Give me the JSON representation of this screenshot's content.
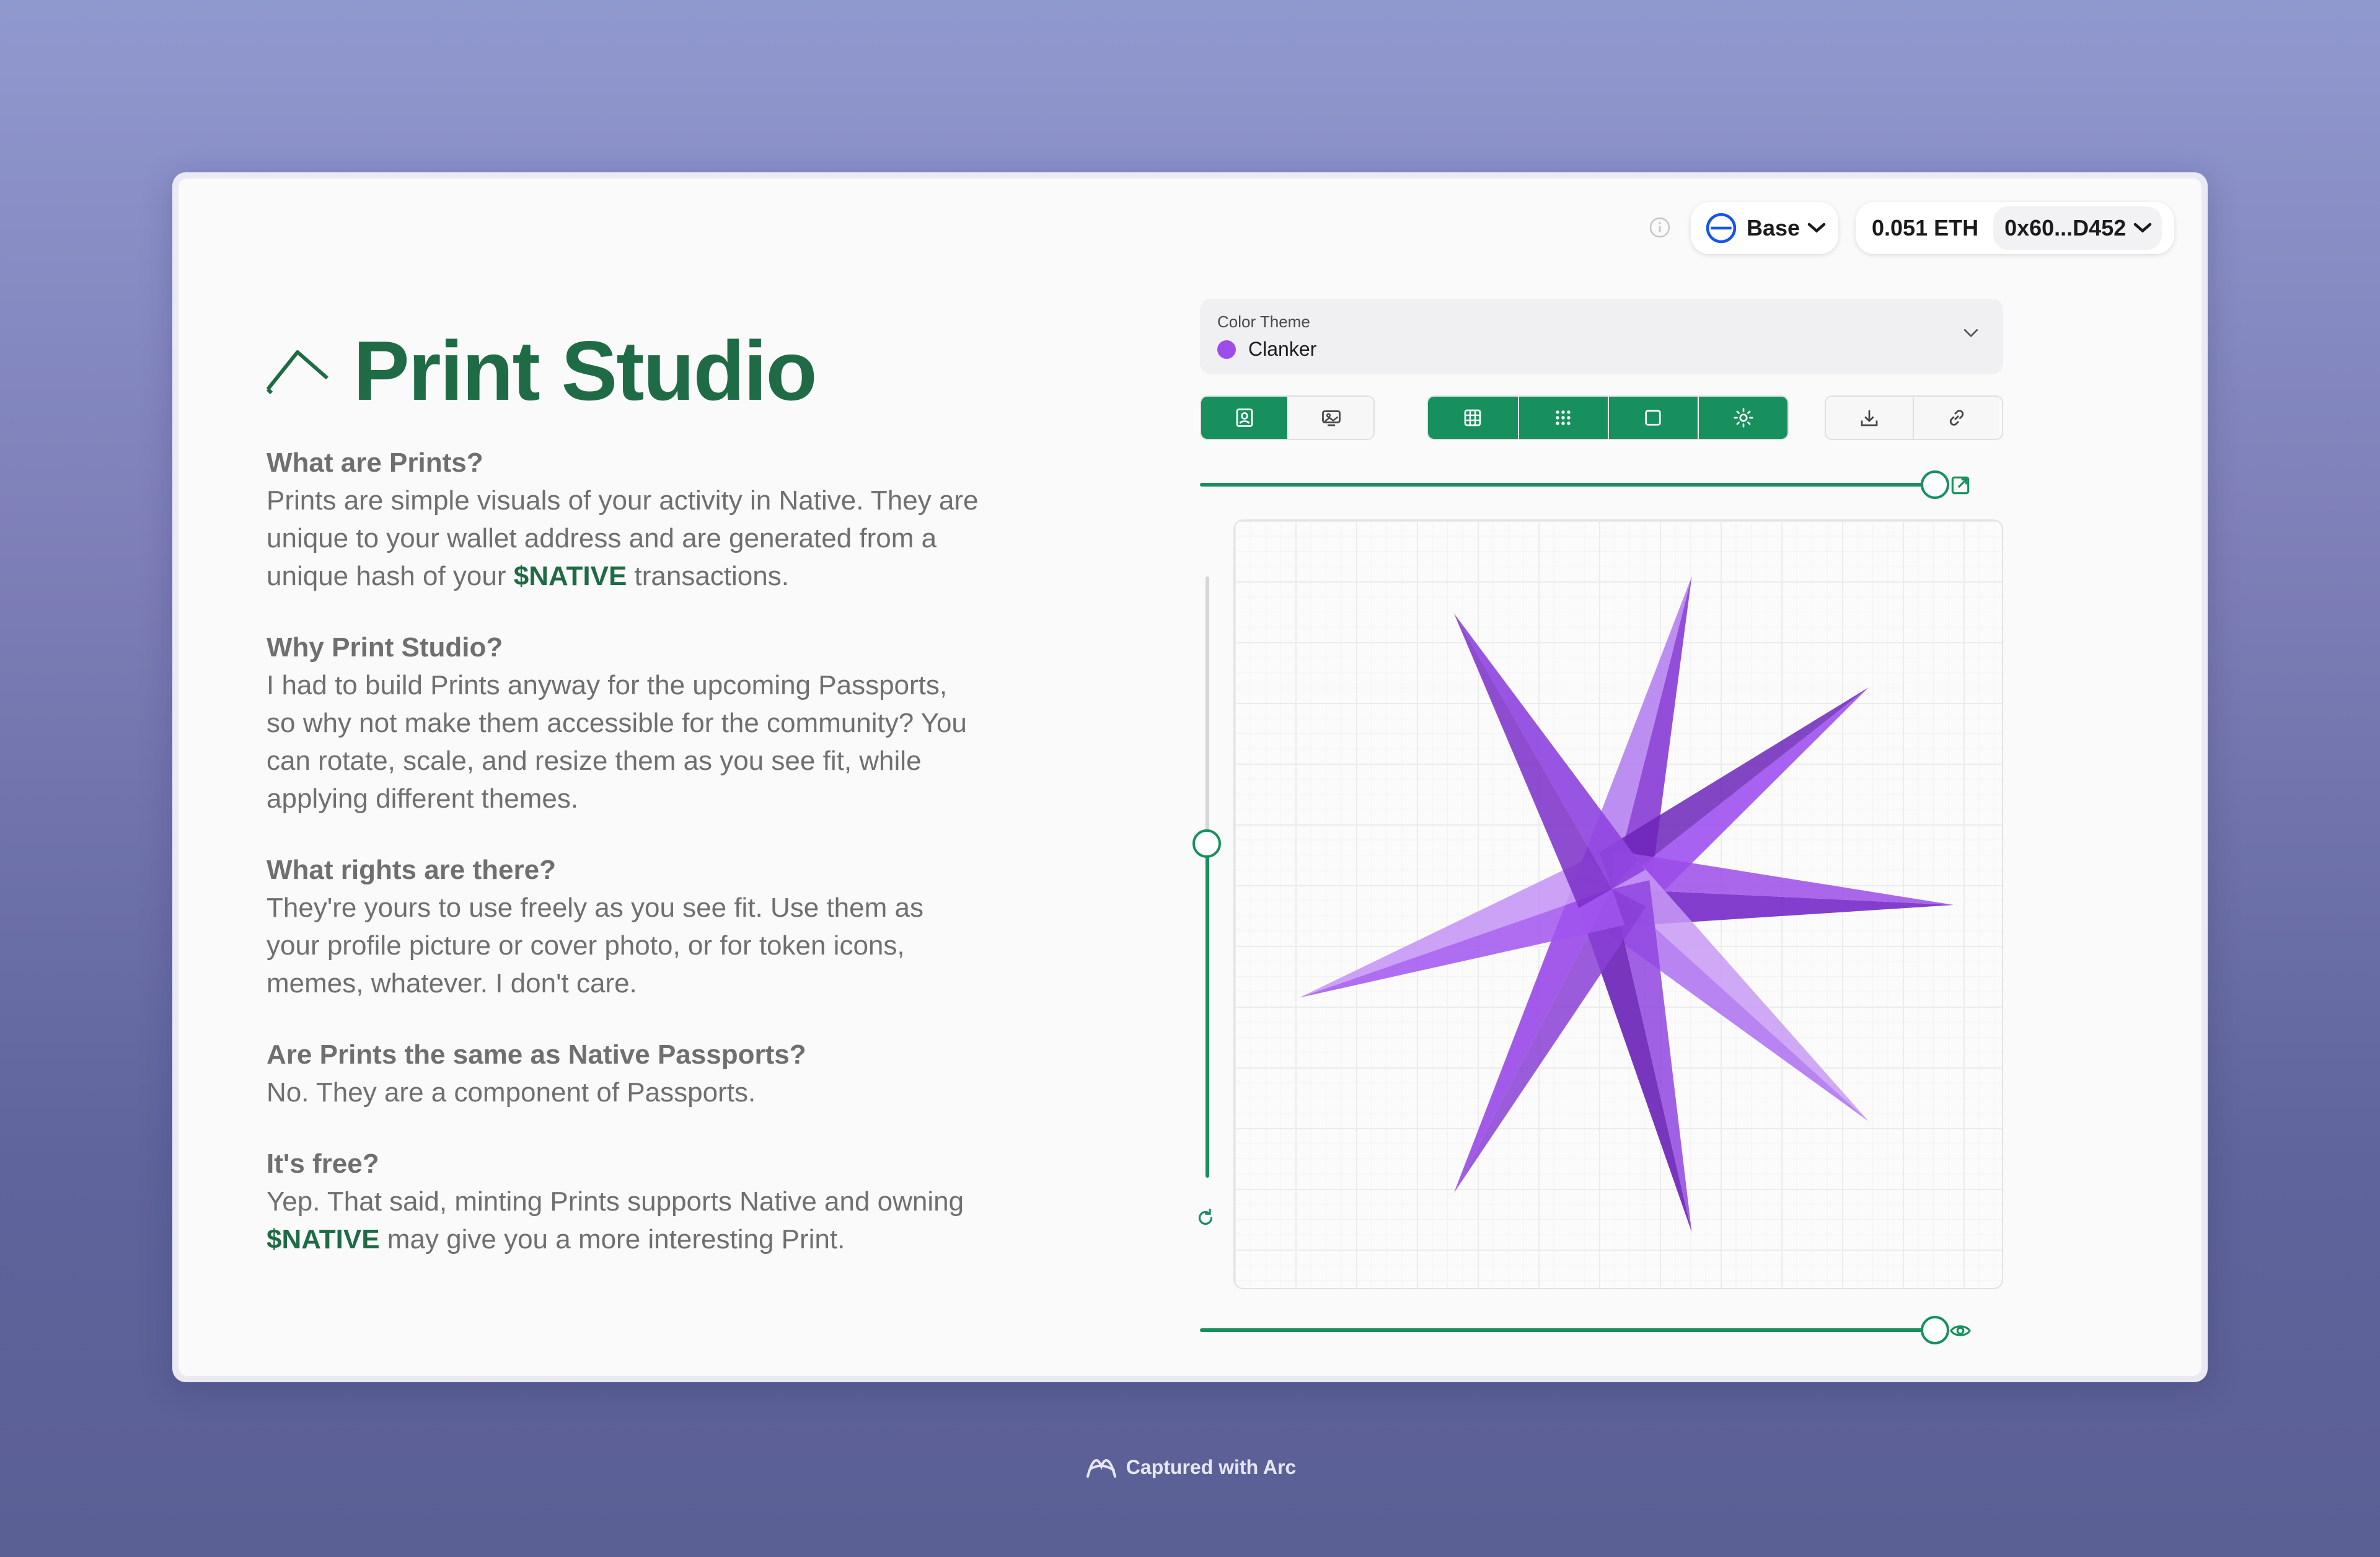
{
  "topbar": {
    "chain_label": "Base",
    "balance": "0.051 ETH",
    "address": "0x60...D452"
  },
  "header": {
    "title": "Print Studio"
  },
  "faq": [
    {
      "q": "What are Prints?",
      "a_before": "Prints are simple visuals of your activity in Native. They are unique to your wallet address and are generated from a unique hash of your ",
      "highlight": "$NATIVE",
      "a_after": " transactions."
    },
    {
      "q": "Why Print Studio?",
      "a": "I had to build Prints anyway for the upcoming Passports, so why not make them accessible for the community? You can rotate, scale, and resize them as you see fit, while applying different themes."
    },
    {
      "q": "What rights are there?",
      "a": "They're yours to use freely as you see fit. Use them as your profile picture or cover photo, or for token icons, memes, whatever. I don't care."
    },
    {
      "q": "Are Prints the same as Native Passports?",
      "a": "No. They are a component of Passports."
    },
    {
      "q": "It's free?",
      "a_before": "Yep. That said, minting Prints supports Native and owning ",
      "highlight": "$NATIVE",
      "a_after": " may give you a more interesting Print."
    }
  ],
  "theme": {
    "label": "Color Theme",
    "value": "Clanker",
    "dot_color": "#9d4ee9"
  },
  "toolbar": {
    "group1": [
      "profile-icon",
      "cover-image-icon"
    ],
    "group2": [
      "grid-icon",
      "dots-grid-icon",
      "square-icon",
      "sun-icon"
    ],
    "group3": [
      "download-icon",
      "link-icon"
    ],
    "active_color": "#17905e"
  },
  "controls": {
    "size_slider": 1.0,
    "rotation_slider": 0.5,
    "opacity_slider": 1.0
  },
  "colors": {
    "brand_green": "#1f6b45",
    "accent_green": "#17905e",
    "star_purple": "#9d4ee9"
  },
  "footer": {
    "text": "Captured with Arc"
  }
}
